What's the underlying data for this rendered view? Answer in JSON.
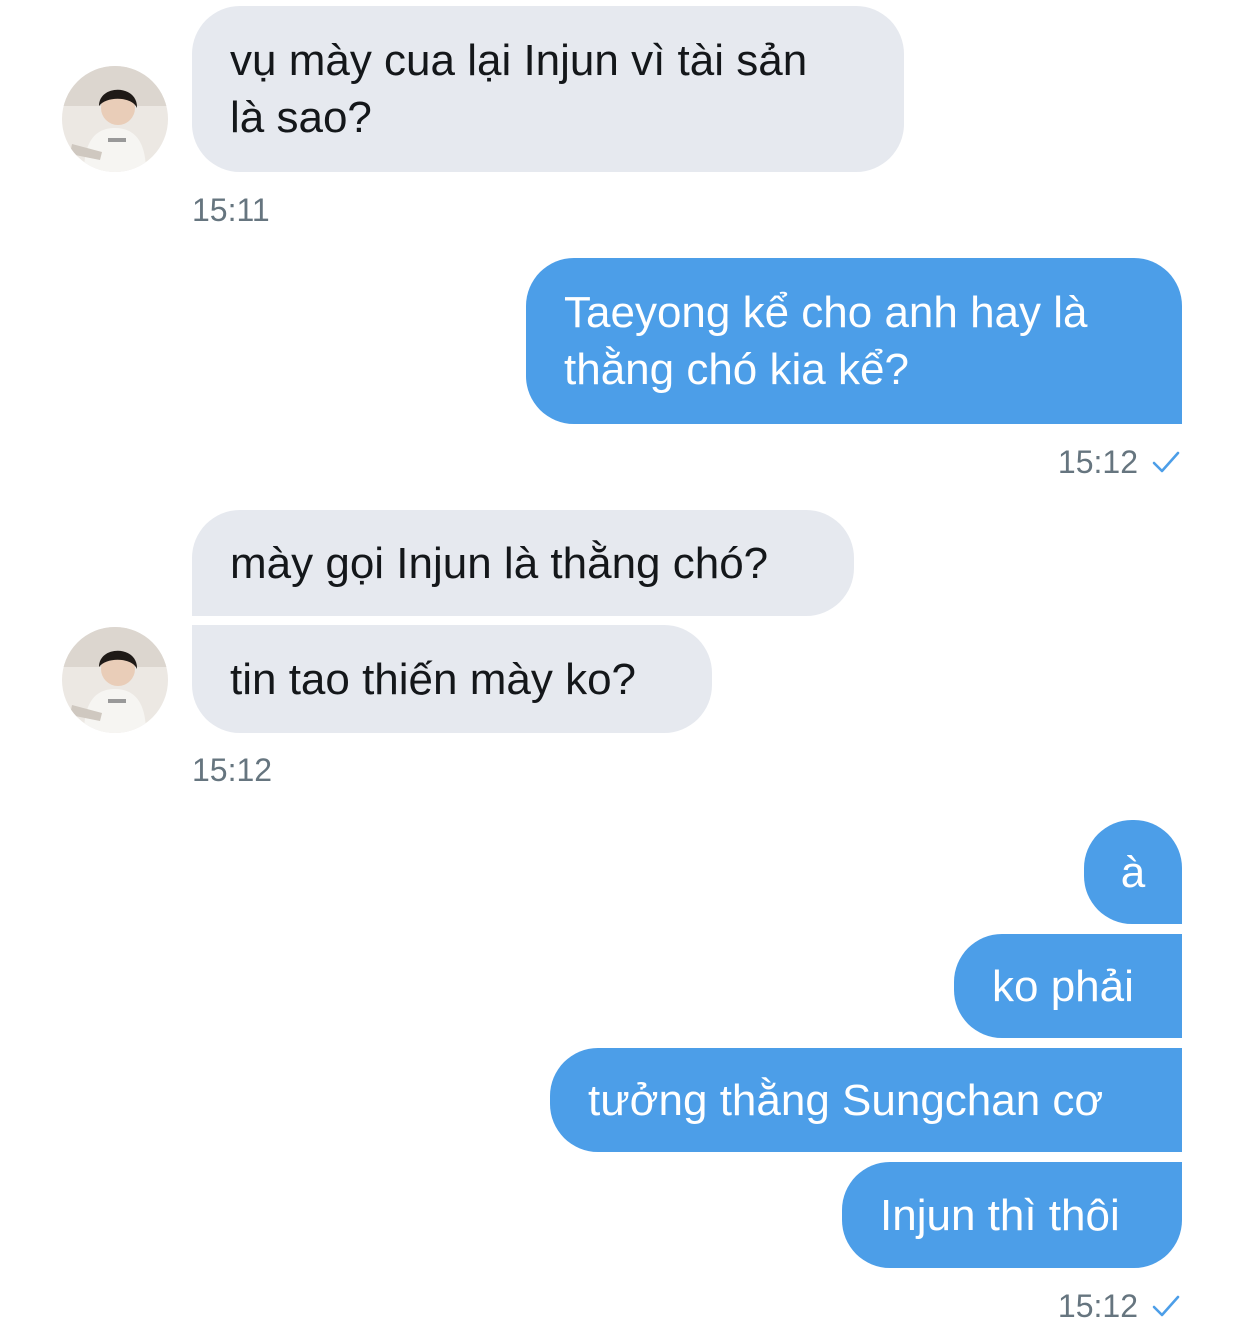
{
  "conversation": {
    "group1": {
      "msg1": "vụ mày cua lại Injun vì tài sản",
      "msg1_line2": "là sao?",
      "time": "15:11"
    },
    "group2": {
      "msg1": "Taeyong kể cho anh hay là",
      "msg1_line2": "thằng chó kia kể?",
      "time": "15:12",
      "status_icon": "check-icon"
    },
    "group3": {
      "msg1": "mày gọi Injun là thằng chó?",
      "msg2": "tin tao thiến mày ko?",
      "time": "15:12"
    },
    "group4": {
      "msg1": "à",
      "msg2": "ko phải",
      "msg3": "tưởng thằng Sungchan cơ",
      "msg4": "Injun thì thôi",
      "time": "15:12",
      "status_icon": "check-icon"
    }
  },
  "colors": {
    "incoming_bubble": "#e6e9ef",
    "outgoing_bubble": "#4c9ee8",
    "timestamp": "#66757f",
    "check": "#4c9ee8"
  }
}
